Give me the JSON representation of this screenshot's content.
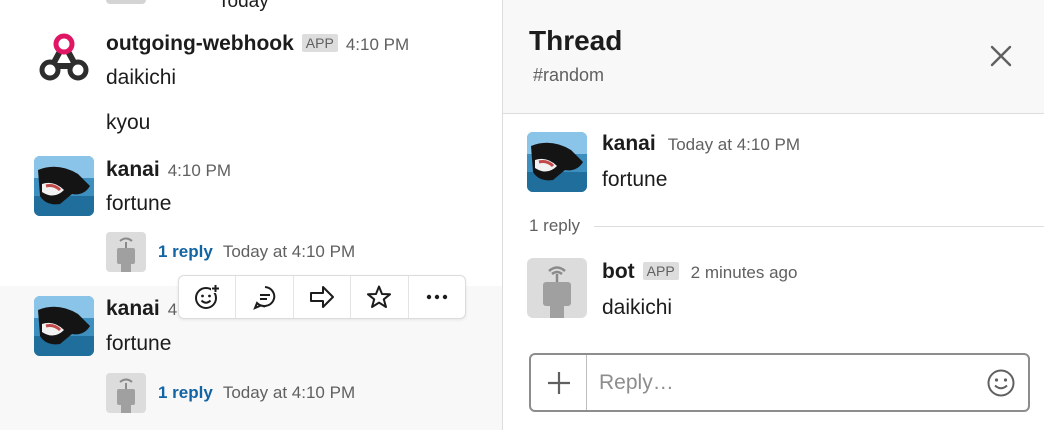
{
  "channel": {
    "top_partial_time": "Today",
    "messages": [
      {
        "author": "outgoing-webhook",
        "badge": "APP",
        "time": "4:10 PM",
        "lines": [
          "daikichi",
          "kyou"
        ],
        "avatar_icon": "webhook-icon"
      },
      {
        "author": "kanai",
        "time": "4:10 PM",
        "text": "fortune",
        "reply_count": "1 reply",
        "reply_time": "Today at 4:10 PM"
      },
      {
        "author": "kanai",
        "time_partial": "4",
        "text": "fortune",
        "reply_count": "1 reply",
        "reply_time": "Today at 4:10 PM"
      }
    ],
    "hover_actions": [
      {
        "name": "add-reaction-icon"
      },
      {
        "name": "reply-in-thread-icon"
      },
      {
        "name": "share-message-icon"
      },
      {
        "name": "star-icon"
      },
      {
        "name": "more-actions-icon"
      }
    ]
  },
  "thread": {
    "title": "Thread",
    "channel_hash": "#",
    "channel_name": "random",
    "parent": {
      "author": "kanai",
      "time": "Today at 4:10 PM",
      "text": "fortune"
    },
    "reply_count": "1 reply",
    "reply": {
      "author": "bot",
      "badge": "APP",
      "time": "2 minutes ago",
      "text": "daikichi"
    },
    "composer": {
      "placeholder": "Reply…"
    }
  },
  "colors": {
    "link": "#1264a3",
    "muted_text": "#616061",
    "webhook_pink": "#e01563",
    "webhook_dark": "#2d2d2d"
  }
}
